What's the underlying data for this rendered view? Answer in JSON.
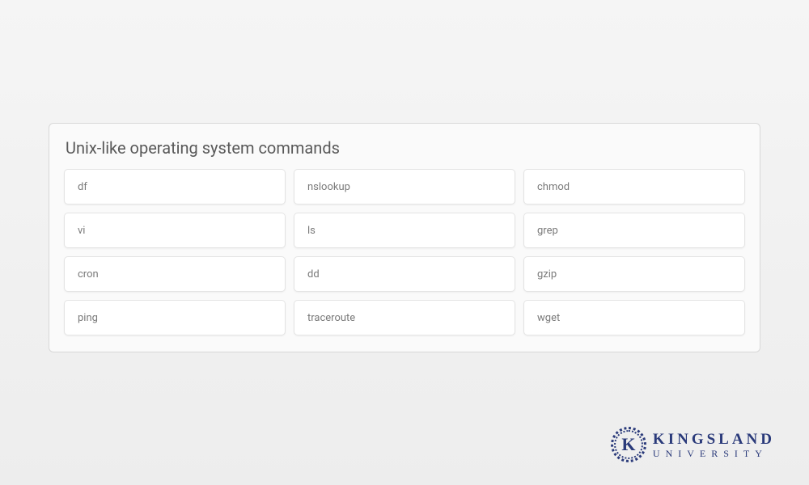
{
  "panel": {
    "title": "Unix-like operating system commands",
    "items": [
      {
        "label": "df"
      },
      {
        "label": "nslookup"
      },
      {
        "label": "chmod"
      },
      {
        "label": "vi"
      },
      {
        "label": "ls"
      },
      {
        "label": "grep"
      },
      {
        "label": "cron"
      },
      {
        "label": "dd"
      },
      {
        "label": "gzip"
      },
      {
        "label": "ping"
      },
      {
        "label": "traceroute"
      },
      {
        "label": "wget"
      }
    ]
  },
  "logo": {
    "letter": "K",
    "line1": "KINGSLAND",
    "line2": "UNIVERSITY"
  }
}
